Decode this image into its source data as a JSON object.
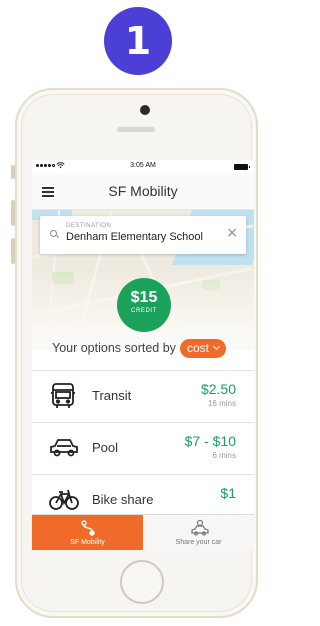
{
  "step_badge": "1",
  "status_bar": {
    "time": "3:05 AM"
  },
  "app_bar": {
    "title": "SF Mobility"
  },
  "search": {
    "label": "DESTINATION",
    "value": "Denham Elementary School"
  },
  "credit": {
    "amount": "$15",
    "label": "CREDIT"
  },
  "sort": {
    "prefix": "Your options sorted by",
    "selected": "cost"
  },
  "options": [
    {
      "label": "Transit",
      "price": "$2.50",
      "time": "16 mins",
      "icon": "bus-icon"
    },
    {
      "label": "Pool",
      "price": "$7 - $10",
      "time": "6 mins",
      "icon": "car-icon"
    },
    {
      "label": "Bike share",
      "price": "$1",
      "time": "",
      "icon": "bicycle-icon"
    }
  ],
  "tabs": [
    {
      "label": "SF Mobility",
      "icon": "route-icon",
      "active": true
    },
    {
      "label": "Share your car",
      "icon": "car-share-icon",
      "active": false
    }
  ],
  "colors": {
    "accent": "#f06b29",
    "credit_green": "#1aa25a",
    "price_green": "#17a35a",
    "badge": "#4b3fd6"
  }
}
